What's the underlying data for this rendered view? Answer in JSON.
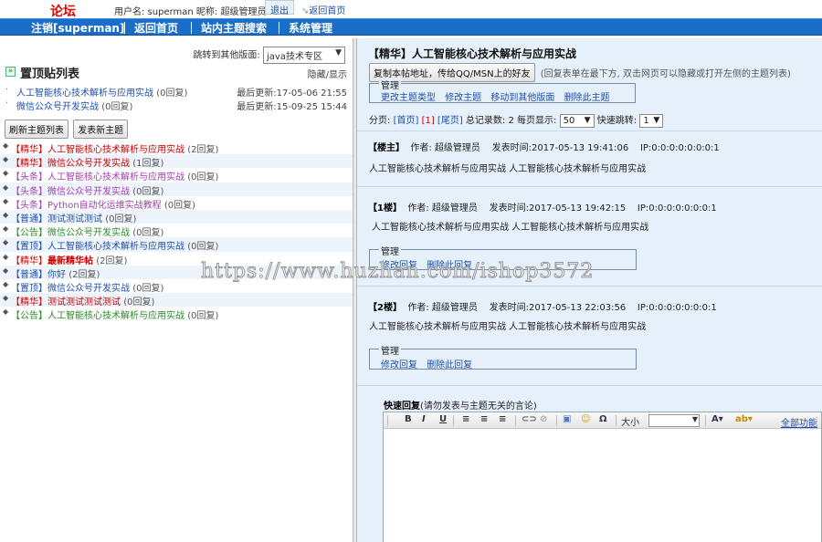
{
  "header": {
    "brand": "论坛",
    "user_info": "用户名: superman 昵称: 超级管理员",
    "logout": "退出",
    "back_home": "返回首页"
  },
  "nav": [
    {
      "label": "注销[superman]"
    },
    {
      "label": "返回首页"
    },
    {
      "label": "站内主题搜索"
    },
    {
      "label": "系统管理"
    }
  ],
  "left": {
    "jump_label": "跳转到其他版面:",
    "jump_value": "java技术专区",
    "pinned_title": "置顶贴列表",
    "toggle": "隐藏/显示",
    "pinned": [
      {
        "title": "人工智能核心技术解析与应用实战",
        "replies": "(0回复)",
        "updated": "最后更新:17-05-06 21:55"
      },
      {
        "title": "微信公众号开发实战",
        "replies": "(0回复)",
        "updated": "最后更新:15-09-25 15:44"
      }
    ],
    "refresh_button": "刷新主题列表",
    "new_topic_button": "发表新主题",
    "topics": [
      {
        "tag": "【精华】",
        "tag_class": "tag-red",
        "title": "人工智能核心技术解析与应用实战",
        "title_class": "tag-red",
        "replies": "(2回复)"
      },
      {
        "tag": "【精华】",
        "tag_class": "tag-red",
        "title": "微信公众号开发实战",
        "title_class": "tag-red",
        "replies": "(1回复)"
      },
      {
        "tag": "【头条】",
        "tag_class": "tag-purple",
        "title": "人工智能核心技术解析与应用实战",
        "title_class": "tag-purple",
        "replies": "(0回复)"
      },
      {
        "tag": "【头条】",
        "tag_class": "tag-purple",
        "title": "微信公众号开发实战",
        "title_class": "tag-purple",
        "replies": "(0回复)"
      },
      {
        "tag": "【头条】",
        "tag_class": "tag-purple",
        "title": "Python自动化运维实战教程",
        "title_class": "tag-purple",
        "replies": "(0回复)"
      },
      {
        "tag": "【普通】",
        "tag_class": "tag-blue",
        "title": "测试测试测试",
        "title_class": "tag-blue",
        "replies": "(0回复)"
      },
      {
        "tag": "【公告】",
        "tag_class": "tag-green",
        "title": "微信公众号开发实战",
        "title_class": "tag-green",
        "replies": "(0回复)"
      },
      {
        "tag": "【置顶】",
        "tag_class": "tag-teal",
        "title": "人工智能核心技术解析与应用实战",
        "title_class": "tag-teal",
        "replies": "(0回复)"
      },
      {
        "tag": "【精华】",
        "tag_class": "tag-red",
        "title": "最新精华帖",
        "title_class": "tag-hot",
        "replies": "(2回复)"
      },
      {
        "tag": "【普通】",
        "tag_class": "tag-blue",
        "title": "你好",
        "title_class": "tag-blue",
        "replies": "(2回复)"
      },
      {
        "tag": "【置顶】",
        "tag_class": "tag-teal",
        "title": "微信公众号开发实战",
        "title_class": "tag-teal",
        "replies": "(0回复)"
      },
      {
        "tag": "【精华】",
        "tag_class": "tag-red",
        "title": "测试测试测试测试",
        "title_class": "tag-red",
        "replies": "(0回复)"
      },
      {
        "tag": "【公告】",
        "tag_class": "tag-green",
        "title": "人工智能核心技术解析与应用实战",
        "title_class": "tag-green",
        "replies": "(0回复)"
      }
    ]
  },
  "right": {
    "thread_title": "【精华】人工智能核心技术解析与应用实战",
    "copy_button": "复制本帖地址，传给QQ/MSN上的好友",
    "copy_hint": "(回复表单在最下方, 双击网页可以隐藏或打开左侧的主题列表)",
    "manage_legend": "管理",
    "manage_links": [
      "更改主题类型",
      "修改主题",
      "移动到其他版面",
      "删除此主题"
    ],
    "pager": {
      "label": "分页:",
      "first": "[首页]",
      "current": "[1]",
      "last": "[尾页]",
      "total": "总记录数: 2",
      "per_page_label": "每页显示:",
      "per_page": "50",
      "jump_label": "快速跳转:",
      "jump_page": "1"
    },
    "posts": [
      {
        "floor": "【楼主】",
        "author": "作者: 超级管理员",
        "time": "发表时间:2017-05-13 19:41:06",
        "ip": "IP:0:0:0:0:0:0:0:1",
        "body": "人工智能核心技术解析与应用实战 人工智能核心技术解析与应用实战"
      },
      {
        "floor": "【1楼】",
        "author": "作者: 超级管理员",
        "time": "发表时间:2017-05-13 19:42:15",
        "ip": "IP:0:0:0:0:0:0:0:1",
        "body": "人工智能核心技术解析与应用实战 人工智能核心技术解析与应用实战"
      },
      {
        "floor": "【2楼】",
        "author": "作者: 超级管理员",
        "time": "发表时间:2017-05-13 22:03:56",
        "ip": "IP:0:0:0:0:0:0:0:1",
        "body": "人工智能核心技术解析与应用实战 人工智能核心技术解析与应用实战"
      }
    ],
    "reply_manage_links": [
      "修改回复",
      "删除此回复"
    ],
    "quick_reply_title": "快速回复",
    "quick_reply_hint": "(请勿发表与主题无关的言论)",
    "toolbar": {
      "bold": "B",
      "italic": "I",
      "underline": "U",
      "font_size_label": "大小",
      "full_features": "全部功能"
    }
  },
  "watermark": "https://www.huzhan.com/ishop3572"
}
